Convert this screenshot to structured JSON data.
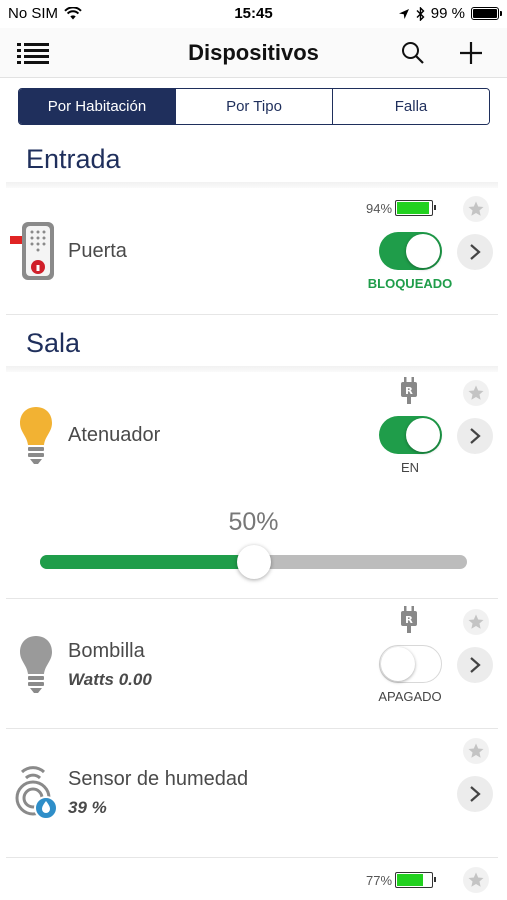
{
  "status_bar": {
    "carrier": "No SIM",
    "time": "15:45",
    "battery_percent": "99 %",
    "battery_level": 0.99
  },
  "nav": {
    "title": "Dispositivos"
  },
  "segmented": {
    "tabs": [
      "Por Habitación",
      "Por Tipo",
      "Falla"
    ],
    "selected_index": 0
  },
  "sections": [
    {
      "title": "Entrada",
      "devices": [
        {
          "name": "Puerta",
          "battery": "94%",
          "battery_level": 0.94,
          "toggle_on": true,
          "state_label": "BLOQUEADO",
          "state_color": "#1f9d4a",
          "icon": "door-lock-icon"
        }
      ]
    },
    {
      "title": "Sala",
      "devices": [
        {
          "name": "Atenuador",
          "toggle_on": true,
          "state_label": "EN",
          "dim_value": "50%",
          "dim_level": 0.5,
          "icon": "lightbulb-on-icon"
        },
        {
          "name": "Bombilla",
          "subtitle": "Watts 0.00",
          "toggle_on": false,
          "state_label": "APAGADO",
          "icon": "lightbulb-off-icon"
        },
        {
          "name": "Sensor de humedad",
          "subtitle": "39 %",
          "icon": "humidity-sensor-icon"
        },
        {
          "battery": "77%",
          "battery_level": 0.77
        }
      ]
    }
  ],
  "colors": {
    "accent_navy": "#1f2f5c",
    "toggle_green": "#1f9d4a",
    "battery_green": "#22d11f",
    "bulb_yellow": "#f2b233"
  }
}
